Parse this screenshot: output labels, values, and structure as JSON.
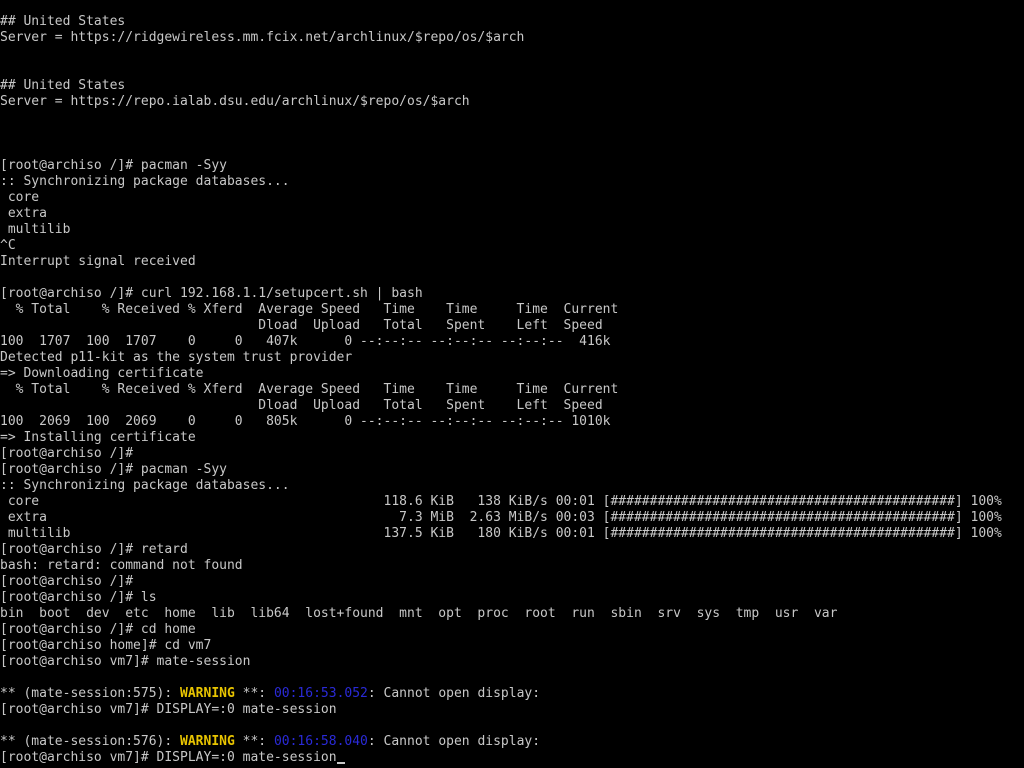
{
  "terminal": {
    "colors": {
      "background": "#000000",
      "text": "#c8c8c8",
      "warning": "#e8c400",
      "timestamp": "#2a2ad8"
    },
    "lines": [
      [
        {
          "t": "## United States"
        }
      ],
      [
        {
          "t": "Server = https://ridgewireless.mm.fcix.net/archlinux/$repo/os/$arch"
        }
      ],
      [],
      [],
      [
        {
          "t": "## United States"
        }
      ],
      [
        {
          "t": "Server = https://repo.ialab.dsu.edu/archlinux/$repo/os/$arch"
        }
      ],
      [],
      [],
      [],
      [
        {
          "t": "[root@archiso /]# pacman -Syy"
        }
      ],
      [
        {
          "t": ":: Synchronizing package databases..."
        }
      ],
      [
        {
          "t": " core"
        }
      ],
      [
        {
          "t": " extra"
        }
      ],
      [
        {
          "t": " multilib"
        }
      ],
      [
        {
          "t": "^C"
        }
      ],
      [
        {
          "t": "Interrupt signal received"
        }
      ],
      [],
      [
        {
          "t": "[root@archiso /]# curl 192.168.1.1/setupcert.sh | bash"
        }
      ],
      [
        {
          "t": "  % Total    % Received % Xferd  Average Speed   Time    Time     Time  Current"
        }
      ],
      [
        {
          "t": "                                 Dload  Upload   Total   Spent    Left  Speed"
        }
      ],
      [
        {
          "t": "100  1707  100  1707    0     0   407k      0 --:--:-- --:--:-- --:--:--  416k"
        }
      ],
      [
        {
          "t": "Detected p11-kit as the system trust provider"
        }
      ],
      [
        {
          "t": "=> Downloading certificate"
        }
      ],
      [
        {
          "t": "  % Total    % Received % Xferd  Average Speed   Time    Time     Time  Current"
        }
      ],
      [
        {
          "t": "                                 Dload  Upload   Total   Spent    Left  Speed"
        }
      ],
      [
        {
          "t": "100  2069  100  2069    0     0   805k      0 --:--:-- --:--:-- --:--:-- 1010k"
        }
      ],
      [
        {
          "t": "=> Installing certificate"
        }
      ],
      [
        {
          "t": "[root@archiso /]#"
        }
      ],
      [
        {
          "t": "[root@archiso /]# pacman -Syy"
        }
      ],
      [
        {
          "t": ":: Synchronizing package databases..."
        }
      ],
      [
        {
          "t": " core                                            118.6 KiB   138 KiB/s 00:01 [############################################] 100%"
        }
      ],
      [
        {
          "t": " extra                                             7.3 MiB  2.63 MiB/s 00:03 [############################################] 100%"
        }
      ],
      [
        {
          "t": " multilib                                        137.5 KiB   180 KiB/s 00:01 [############################################] 100%"
        }
      ],
      [
        {
          "t": "[root@archiso /]# retard"
        }
      ],
      [
        {
          "t": "bash: retard: command not found"
        }
      ],
      [
        {
          "t": "[root@archiso /]#"
        }
      ],
      [
        {
          "t": "[root@archiso /]# ls"
        }
      ],
      [
        {
          "t": "bin  boot  dev  etc  home  lib  lib64  lost+found  mnt  opt  proc  root  run  sbin  srv  sys  tmp  usr  var"
        }
      ],
      [
        {
          "t": "[root@archiso /]# cd home"
        }
      ],
      [
        {
          "t": "[root@archiso home]# cd vm7"
        }
      ],
      [
        {
          "t": "[root@archiso vm7]# mate-session"
        }
      ],
      [],
      [
        {
          "t": "** (mate-session:575): "
        },
        {
          "t": "WARNING",
          "c": "warning"
        },
        {
          "t": " **: "
        },
        {
          "t": "00:16:53.052",
          "c": "time"
        },
        {
          "t": ": Cannot open display:"
        }
      ],
      [
        {
          "t": "[root@archiso vm7]# DISPLAY=:0 mate-session"
        }
      ],
      [],
      [
        {
          "t": "** (mate-session:576): "
        },
        {
          "t": "WARNING",
          "c": "warning"
        },
        {
          "t": " **: "
        },
        {
          "t": "00:16:58.040",
          "c": "time"
        },
        {
          "t": ": Cannot open display:"
        }
      ],
      [
        {
          "t": "[root@archiso vm7]# DISPLAY=:0 mate-session"
        },
        {
          "t": "",
          "cursor": true
        }
      ]
    ]
  }
}
